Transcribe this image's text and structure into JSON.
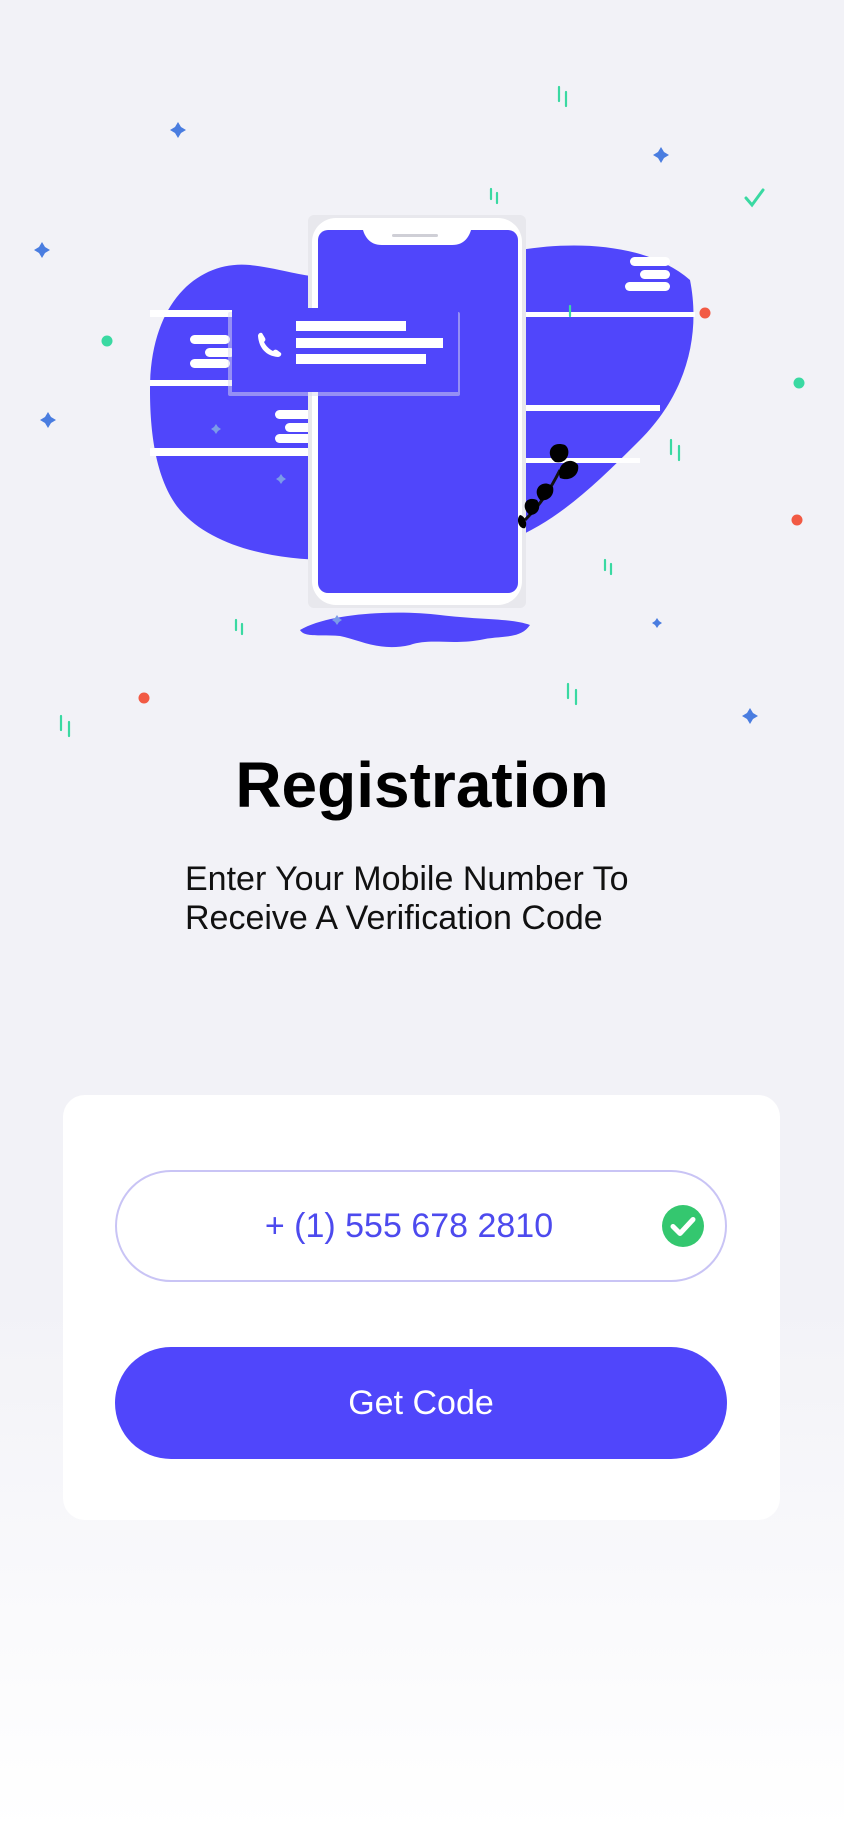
{
  "header": {
    "title": "Registration",
    "subtitle_line1": "Enter Your Mobile Number To",
    "subtitle_line2": "Receive A Verification Code"
  },
  "form": {
    "phone_value": "+ (1) 555 678 2810",
    "phone_valid": true,
    "get_code_label": "Get Code"
  },
  "colors": {
    "accent": "#5046FB",
    "success": "#34C76F",
    "background": "#F2F2F7"
  },
  "icons": {
    "illustration": "phone-message-illustration",
    "call": "phone-icon",
    "valid": "check-circle-icon"
  }
}
